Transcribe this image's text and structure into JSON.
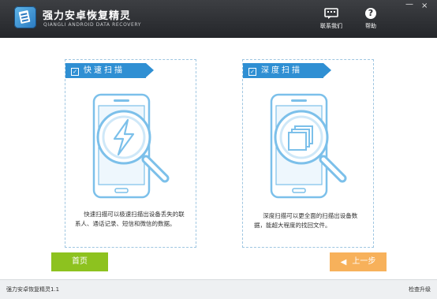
{
  "app": {
    "title": "强力安卓恢复精灵",
    "subtitle": "QIANGLI ANDROID DATA RECOVERY"
  },
  "header": {
    "contact_label": "联系我们",
    "help_label": "帮助",
    "help_glyph": "?",
    "minimize_glyph": "—",
    "close_glyph": "×"
  },
  "cards": {
    "quick": {
      "title": "快速扫描",
      "check_glyph": "✓",
      "description": "快速扫描可以极速扫描出设备丢失的联系人、通话记录、短信和微信的数据。",
      "icon": "lightning-icon"
    },
    "deep": {
      "title": "深度扫描",
      "check_glyph": "✓",
      "description": "深度扫描可以更全面的扫描出设备数据，能超大程度的找回文件。",
      "icon": "layers-icon"
    }
  },
  "buttons": {
    "home_label": "首页",
    "back_label": "上一步",
    "back_arrow": "◀"
  },
  "status": {
    "version": "强力安卓恢复精灵1.1",
    "right_label": "检查升级"
  },
  "colors": {
    "header_bg": "#2b2d31",
    "accent_blue": "#2f8fd3",
    "illustration_blue": "#7cc0ea",
    "home_green": "#8dc21f",
    "back_orange": "#f7b15b"
  }
}
